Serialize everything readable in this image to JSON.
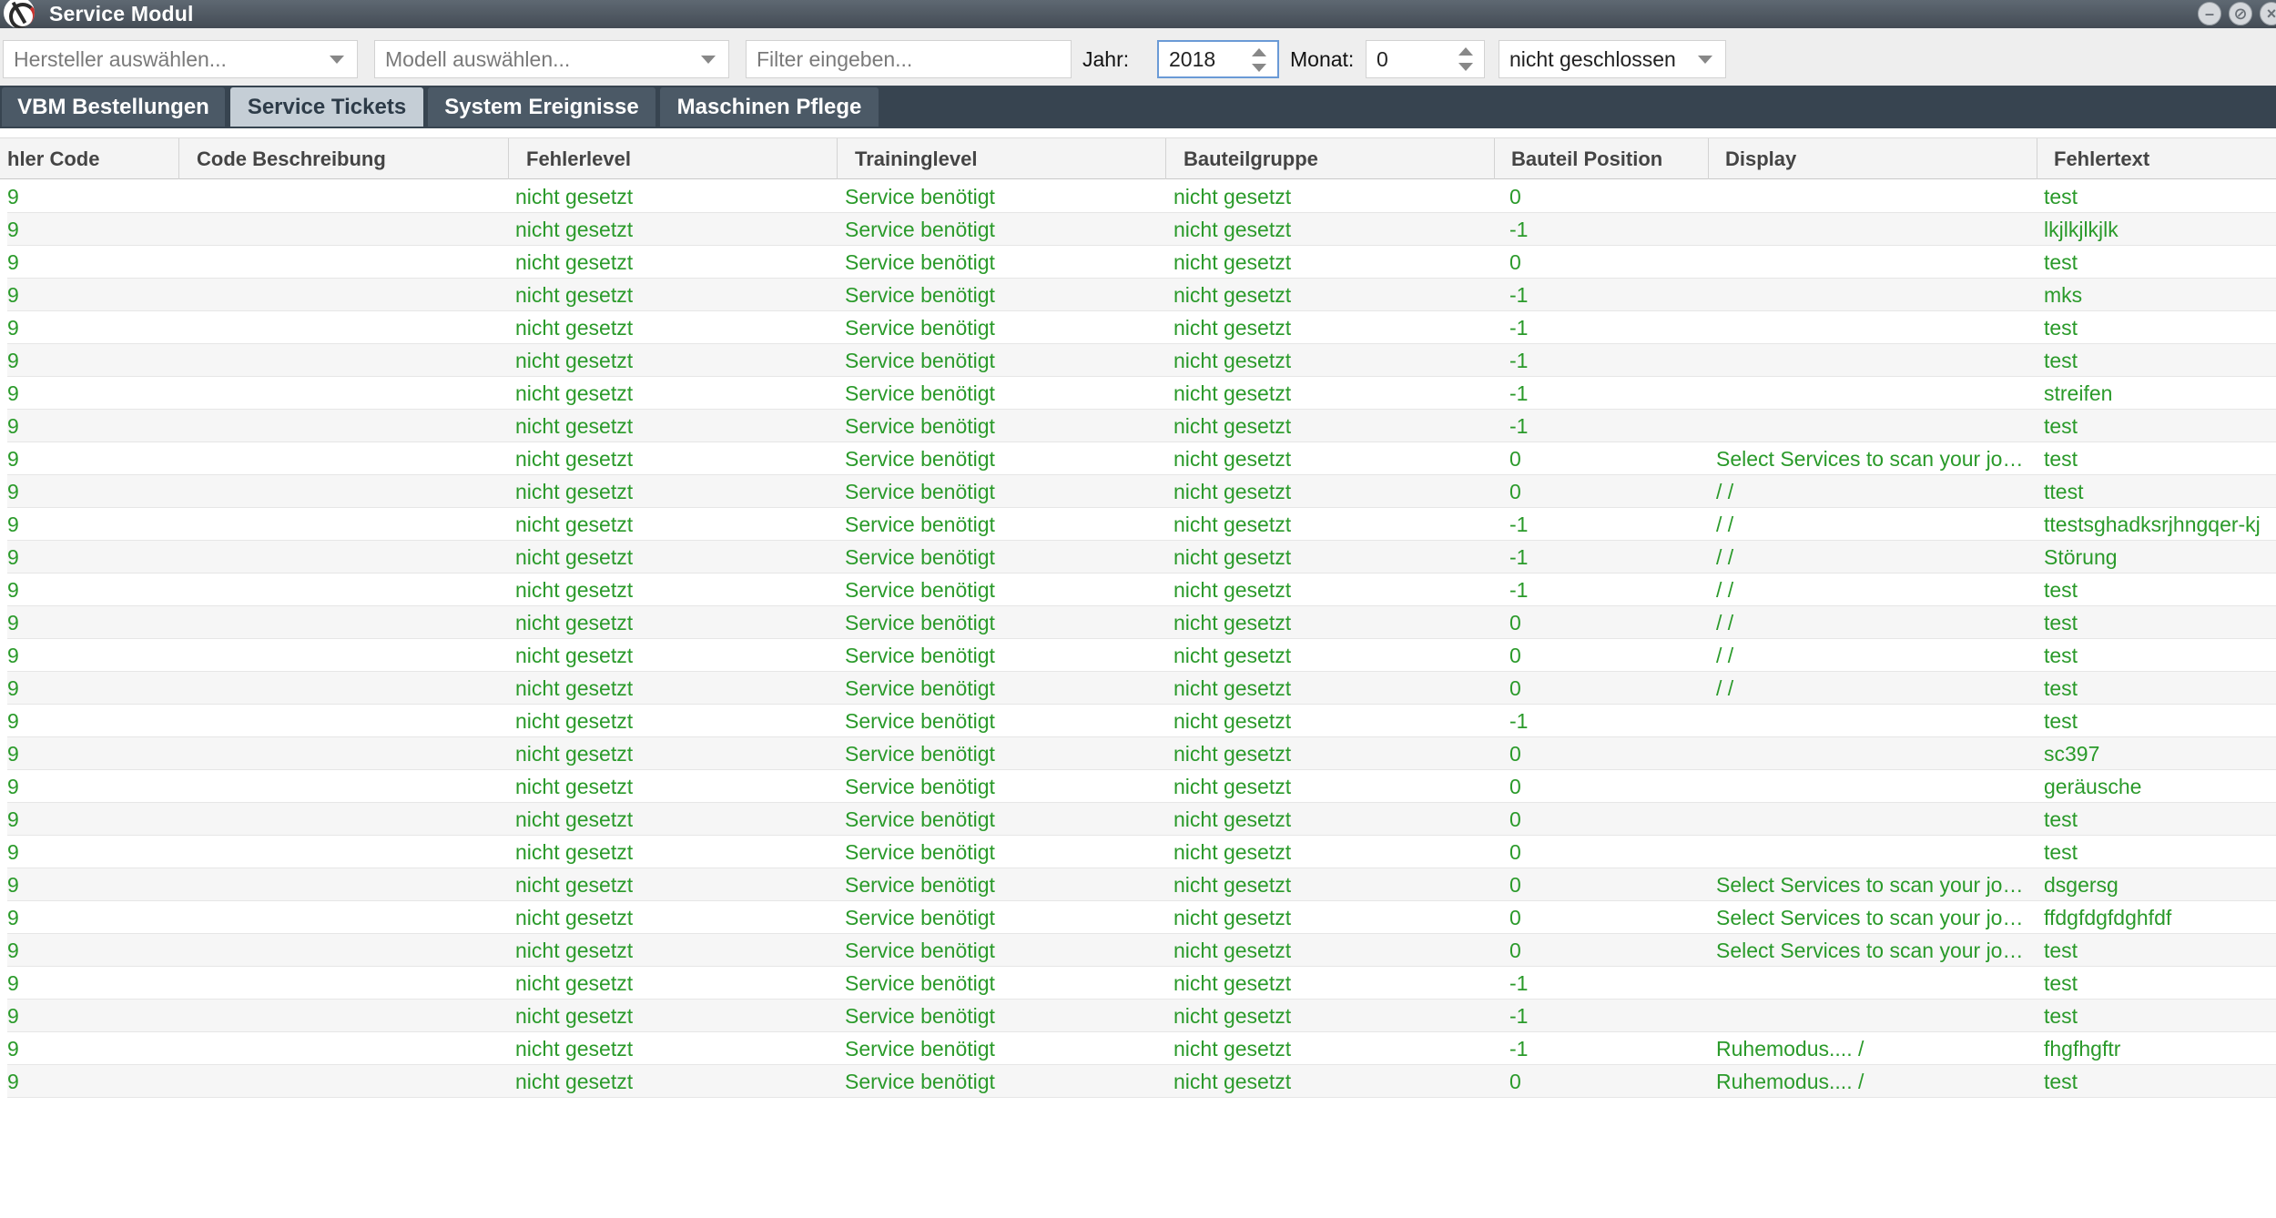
{
  "window": {
    "title": "Service Modul"
  },
  "toolbar": {
    "manufacturer_placeholder": "Hersteller auswählen...",
    "model_placeholder": "Modell auswählen...",
    "filter_placeholder": "Filter eingeben...",
    "year_label": "Jahr:",
    "year_value": "2018",
    "month_label": "Monat:",
    "month_value": "0",
    "status_value": "nicht geschlossen"
  },
  "tabs": [
    {
      "label": "VBM Bestellungen",
      "active": false
    },
    {
      "label": "Service Tickets",
      "active": true
    },
    {
      "label": "System Ereignisse",
      "active": false
    },
    {
      "label": "Maschinen Pflege",
      "active": false
    }
  ],
  "table": {
    "columns": [
      "hler Code",
      "Code Beschreibung",
      "Fehlerlevel",
      "Traininglevel",
      "Bauteilgruppe",
      "Bauteil Position",
      "Display",
      "Fehlertext"
    ],
    "rows": [
      [
        "9",
        "",
        "nicht gesetzt",
        "Service benötigt",
        "nicht gesetzt",
        "0",
        "",
        "test"
      ],
      [
        "9",
        "",
        "nicht gesetzt",
        "Service benötigt",
        "nicht gesetzt",
        "-1",
        "",
        "lkjlkjlkjlk"
      ],
      [
        "9",
        "",
        "nicht gesetzt",
        "Service benötigt",
        "nicht gesetzt",
        "0",
        "",
        "test"
      ],
      [
        "9",
        "",
        "nicht gesetzt",
        "Service benötigt",
        "nicht gesetzt",
        "-1",
        "",
        "mks"
      ],
      [
        "9",
        "",
        "nicht gesetzt",
        "Service benötigt",
        "nicht gesetzt",
        "-1",
        "",
        "test"
      ],
      [
        "9",
        "",
        "nicht gesetzt",
        "Service benötigt",
        "nicht gesetzt",
        "-1",
        "",
        "test"
      ],
      [
        "9",
        "",
        "nicht gesetzt",
        "Service benötigt",
        "nicht gesetzt",
        "-1",
        "",
        "streifen"
      ],
      [
        "9",
        "",
        "nicht gesetzt",
        "Service benötigt",
        "nicht gesetzt",
        "-1",
        "",
        "test"
      ],
      [
        "9",
        "",
        "nicht gesetzt",
        "Service benötigt",
        "nicht gesetzt",
        "0",
        "Select Services to scan your jo…",
        "test"
      ],
      [
        "9",
        "",
        "nicht gesetzt",
        "Service benötigt",
        "nicht gesetzt",
        "0",
        "/ /",
        "ttest"
      ],
      [
        "9",
        "",
        "nicht gesetzt",
        "Service benötigt",
        "nicht gesetzt",
        "-1",
        "/ /",
        "ttestsghadksrjhngqer-kj"
      ],
      [
        "9",
        "",
        "nicht gesetzt",
        "Service benötigt",
        "nicht gesetzt",
        "-1",
        "/ /",
        "Störung"
      ],
      [
        "9",
        "",
        "nicht gesetzt",
        "Service benötigt",
        "nicht gesetzt",
        "-1",
        "/ /",
        "test"
      ],
      [
        "9",
        "",
        "nicht gesetzt",
        "Service benötigt",
        "nicht gesetzt",
        "0",
        "/ /",
        "test"
      ],
      [
        "9",
        "",
        "nicht gesetzt",
        "Service benötigt",
        "nicht gesetzt",
        "0",
        "/ /",
        "test"
      ],
      [
        "9",
        "",
        "nicht gesetzt",
        "Service benötigt",
        "nicht gesetzt",
        "0",
        "/ /",
        "test"
      ],
      [
        "9",
        "",
        "nicht gesetzt",
        "Service benötigt",
        "nicht gesetzt",
        "-1",
        "",
        "test"
      ],
      [
        "9",
        "",
        "nicht gesetzt",
        "Service benötigt",
        "nicht gesetzt",
        "0",
        "",
        "sc397"
      ],
      [
        "9",
        "",
        "nicht gesetzt",
        "Service benötigt",
        "nicht gesetzt",
        "0",
        "",
        "geräusche"
      ],
      [
        "9",
        "",
        "nicht gesetzt",
        "Service benötigt",
        "nicht gesetzt",
        "0",
        "",
        "test"
      ],
      [
        "9",
        "",
        "nicht gesetzt",
        "Service benötigt",
        "nicht gesetzt",
        "0",
        "",
        "test"
      ],
      [
        "9",
        "",
        "nicht gesetzt",
        "Service benötigt",
        "nicht gesetzt",
        "0",
        "Select Services to scan your jo…",
        "dsgersg"
      ],
      [
        "9",
        "",
        "nicht gesetzt",
        "Service benötigt",
        "nicht gesetzt",
        "0",
        "Select Services to scan your jo…",
        "ffdgfdgfdghfdf"
      ],
      [
        "9",
        "",
        "nicht gesetzt",
        "Service benötigt",
        "nicht gesetzt",
        "0",
        "Select Services to scan your jo…",
        "test"
      ],
      [
        "9",
        "",
        "nicht gesetzt",
        "Service benötigt",
        "nicht gesetzt",
        "-1",
        "",
        "test"
      ],
      [
        "9",
        "",
        "nicht gesetzt",
        "Service benötigt",
        "nicht gesetzt",
        "-1",
        "",
        "test"
      ],
      [
        "9",
        "",
        "nicht gesetzt",
        "Service benötigt",
        "nicht gesetzt",
        "-1",
        "Ruhemodus.... /",
        "fhgfhgftr"
      ],
      [
        "9",
        "",
        "nicht gesetzt",
        "Service benötigt",
        "nicht gesetzt",
        "0",
        "Ruhemodus.... /",
        "test"
      ]
    ]
  },
  "colors": {
    "titlebar": "#4e5761",
    "tabbar": "#374450",
    "active_tab": "#c5ced6",
    "cell_text": "#2a9a2a"
  }
}
